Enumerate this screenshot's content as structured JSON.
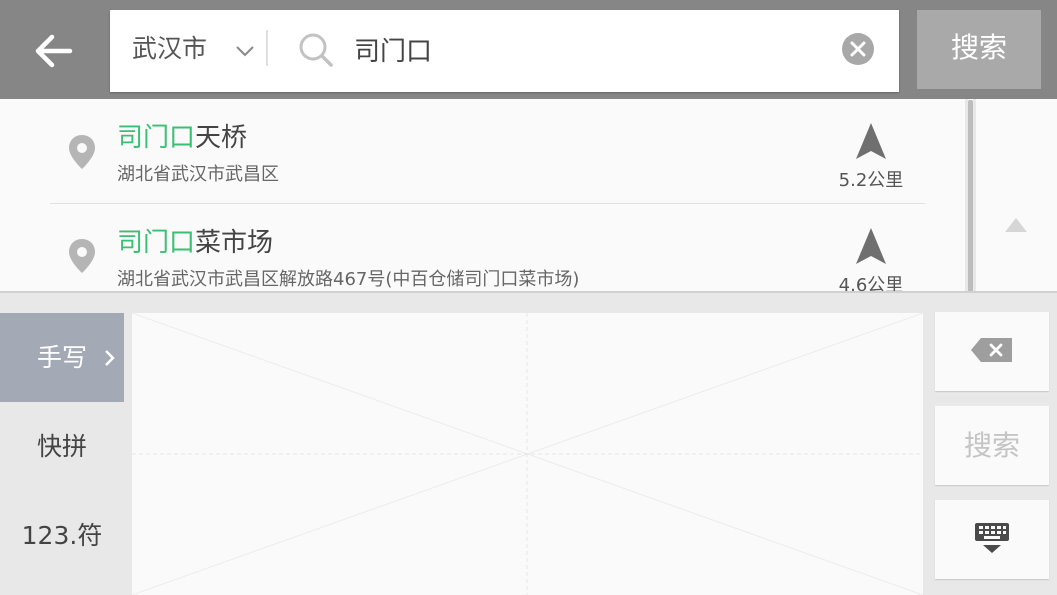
{
  "header": {
    "city": "武汉市",
    "query": "司门口",
    "search_label": "搜索"
  },
  "results": [
    {
      "highlight": "司门口",
      "rest": "天桥",
      "address": "湖北省武汉市武昌区",
      "distance": "5.2公里"
    },
    {
      "highlight": "司门口",
      "rest": "菜市场",
      "address": "湖北省武汉市武昌区解放路467号(中百仓储司门口菜市场)",
      "distance": "4.6公里"
    }
  ],
  "keyboard": {
    "modes": [
      {
        "label": "手写",
        "active": true
      },
      {
        "label": "快拼",
        "active": false
      },
      {
        "label": "123.符",
        "active": false
      }
    ],
    "search_key": "搜索"
  },
  "colors": {
    "topbar": "#868686",
    "highlight": "#3bbf74",
    "active_mode": "#a3a9b5"
  }
}
